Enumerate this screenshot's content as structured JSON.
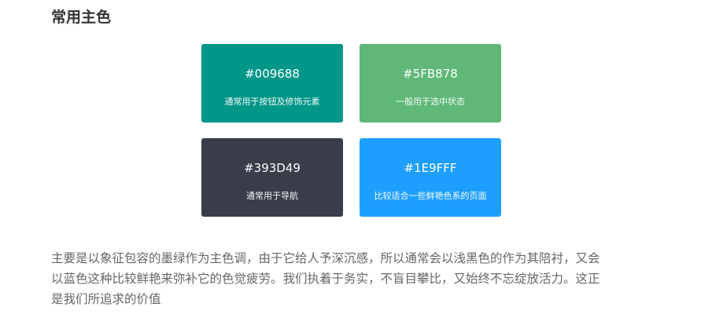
{
  "section": {
    "title": "常用主色"
  },
  "swatches": [
    {
      "hex": "#009688",
      "desc": "通常用于按钮及修饰元素",
      "color": "#009688"
    },
    {
      "hex": "#5FB878",
      "desc": "一般用于选中状态",
      "color": "#5FB878"
    },
    {
      "hex": "#393D49",
      "desc": "通常用于导航",
      "color": "#393D49"
    },
    {
      "hex": "#1E9FFF",
      "desc": "比较适合一些鲜艳色系的页面",
      "color": "#1E9FFF"
    }
  ],
  "paragraph": {
    "text": "主要是以象征包容的墨绿作为主色调，由于它给人予深沉感，所以通常会以浅黑色的作为其陪衬，又会以蓝色这种比较鲜艳来弥补它的色觉疲劳。我们执着于务实，不盲目攀比，又始终不忘绽放活力。这正是我们所追求的价值"
  }
}
